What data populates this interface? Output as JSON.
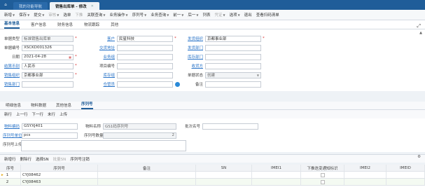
{
  "titlebar": {
    "home_icon": "home-icon",
    "tabs": [
      {
        "label": "我的功能导航",
        "active": false
      },
      {
        "label": "销售出库单 - 修改",
        "active": true
      }
    ]
  },
  "toolbar": {
    "items": [
      {
        "label": "新增",
        "dd": true
      },
      {
        "label": "保存",
        "dd": true
      },
      {
        "label": "提交",
        "dd": true
      },
      {
        "label": "审核",
        "dd": true,
        "disabled": true
      },
      {
        "label": "选单",
        "dd": false
      },
      {
        "label": "下推",
        "dd": false,
        "disabled": true
      },
      {
        "label": "关联查询",
        "dd": true
      },
      {
        "label": "业务操作",
        "dd": true
      },
      {
        "label": "序列号",
        "dd": true
      },
      {
        "label": "业务查询",
        "dd": true
      },
      {
        "label": "前一",
        "dd": true
      },
      {
        "label": "后一",
        "dd": true
      },
      {
        "label": "列表",
        "dd": false
      },
      {
        "label": "凭证",
        "dd": true,
        "disabled": true
      },
      {
        "label": "选项",
        "dd": true
      },
      {
        "label": "退出",
        "dd": false
      },
      {
        "label": "查看扫码清单",
        "dd": false
      }
    ]
  },
  "main_tabs": [
    "基本信息",
    "客户信息",
    "财务信息",
    "物流跟踪",
    "其他"
  ],
  "form": {
    "bill_type": {
      "label": "单据类型",
      "value": "标准销售出库单"
    },
    "bill_no": {
      "label": "单据编号",
      "value": "XSCKD001326"
    },
    "date": {
      "label": "日期",
      "value": "2021-04-28"
    },
    "currency": {
      "label": "结算币别",
      "value": "人民币"
    },
    "sales_org": {
      "label": "销售组织",
      "value": "京都事业部"
    },
    "sales_dept": {
      "label": "销售部门",
      "value": ""
    },
    "customer": {
      "label": "客户",
      "value": "民星科技"
    },
    "consignee": {
      "label": "交货地址",
      "value": ""
    },
    "salesman_group": {
      "label": "业务组",
      "value": ""
    },
    "project_no": {
      "label": "项目编号",
      "value": ""
    },
    "stock_group": {
      "label": "库存组",
      "value": ""
    },
    "stockkeeper": {
      "label": "仓管员",
      "value": ""
    },
    "delivery_org": {
      "label": "发货组织",
      "value": "京都事业部"
    },
    "delivery_dept": {
      "label": "发货部门",
      "value": ""
    },
    "stock_dept": {
      "label": "库存部门",
      "value": ""
    },
    "receiver": {
      "label": "收货方",
      "value": ""
    },
    "doc_status": {
      "label": "单据状态",
      "value": "创建"
    },
    "remark": {
      "label": "备注",
      "value": ""
    }
  },
  "detail_tabs": [
    "明细信息",
    "物料数据",
    "其他信息",
    "序列号"
  ],
  "subbar_items": [
    "新行",
    "上一行",
    "下一行",
    "末行",
    "上传"
  ],
  "serial_form": {
    "material_code": {
      "label": "物料编码",
      "value": "GSYXJ401"
    },
    "material_name": {
      "label": "物料名称",
      "value": "GS1码序列号"
    },
    "batch_no": {
      "label": "批次名号",
      "value": ""
    },
    "unit": {
      "label": "序列号单位",
      "value": "pcs"
    },
    "qty": {
      "label": "序列号数量",
      "value": "2"
    },
    "upload": {
      "label": "序列号上传",
      "value": ""
    }
  },
  "grid_toolbar": [
    "新增行",
    "删除行",
    "选择SN",
    "批量SN",
    "序列号注销"
  ],
  "grid": {
    "headers": [
      "序号",
      "序列号",
      "备注",
      "SN",
      "IMEI1",
      "下推迭变通知标识",
      "IMEI2",
      "IMEID"
    ],
    "rows": [
      {
        "no": "1",
        "serial": "CYJ08462",
        "remark": "",
        "sn": "",
        "imei1": "",
        "imei2": "",
        "imeid": ""
      },
      {
        "no": "2",
        "serial": "CYJ08463",
        "remark": "",
        "sn": "",
        "imei1": "",
        "imei2": "",
        "imeid": ""
      }
    ]
  }
}
